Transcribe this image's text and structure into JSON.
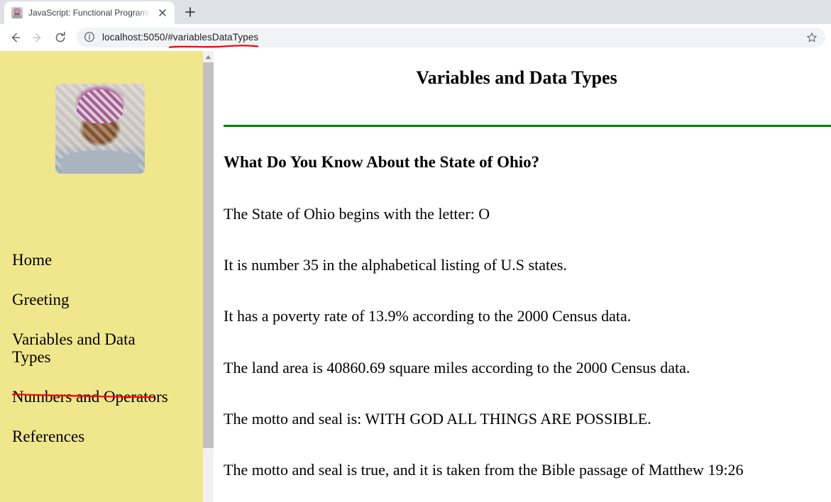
{
  "browser": {
    "tab": {
      "title": "JavaScript: Functional Programmi",
      "favicon_name": "portrait-favicon",
      "close_label": "✕"
    },
    "new_tab_label": "+",
    "nav": {
      "back_label": "←",
      "forward_label": "→",
      "reload_label": "↻"
    },
    "omnibox": {
      "url": "localhost:5050/#variablesDataTypes",
      "info_icon": "info-circle-icon",
      "star_icon": "star-outline-icon"
    },
    "colors": {
      "tabstrip_bg": "#dee1e6",
      "omnibox_bg": "#f1f3f4",
      "annotation_red": "#ff0000"
    }
  },
  "sidebar": {
    "background": "#f0e68c",
    "portrait_alt": "profile-photo",
    "items": [
      {
        "label": "Home"
      },
      {
        "label": "Greeting"
      },
      {
        "label": "Variables and Data Types"
      },
      {
        "label": "Numbers and Operators"
      },
      {
        "label": "References"
      }
    ],
    "scrollbar": {
      "up_arrow": "▲"
    }
  },
  "main": {
    "title": "Variables and Data Types",
    "rule_color": "#008000",
    "section_title": "What Do You Know About the State of Ohio?",
    "paragraphs": [
      "The State of Ohio begins with the letter: O",
      "It is number 35 in the alphabetical listing of U.S states.",
      "It has a poverty rate of 13.9% according to the 2000 Census data.",
      "The land area is 40860.69 square miles according to the 2000 Census data.",
      "The motto and seal is: WITH GOD ALL THINGS ARE POSSIBLE.",
      "The motto and seal is true, and it is taken from the Bible passage of Matthew 19:26"
    ]
  }
}
